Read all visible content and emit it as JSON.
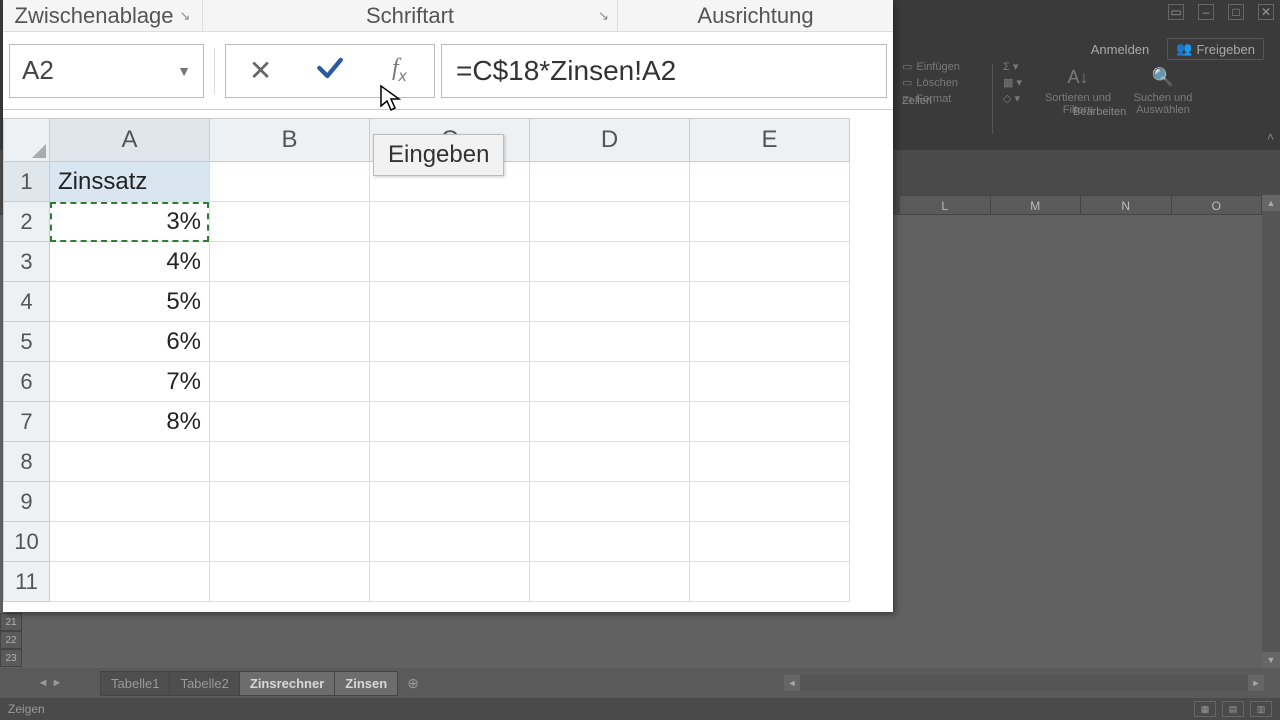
{
  "ribbon": {
    "groups": {
      "clipboard": "Zwischenablage",
      "font": "Schriftart",
      "alignment": "Ausrichtung"
    }
  },
  "account": {
    "login": "Anmelden",
    "share": "Freigeben"
  },
  "right_ribbon": {
    "cells": {
      "insert": "Einfügen",
      "delete": "Löschen",
      "format": "Format",
      "section": "Zellen"
    },
    "editing": {
      "sort": "Sortieren und Filtern",
      "find": "Suchen und Auswählen",
      "section": "Bearbeiten"
    }
  },
  "namebox": "A2",
  "formula": "=C$18*Zinsen!A2",
  "tooltip": "Eingeben",
  "columns": [
    "A",
    "B",
    "C",
    "D",
    "E"
  ],
  "bg_columns": [
    "L",
    "M",
    "N",
    "O"
  ],
  "rows": [
    {
      "n": "1",
      "A": "Zinssatz"
    },
    {
      "n": "2",
      "A": "3%"
    },
    {
      "n": "3",
      "A": "4%"
    },
    {
      "n": "4",
      "A": "5%"
    },
    {
      "n": "5",
      "A": "6%"
    },
    {
      "n": "6",
      "A": "7%"
    },
    {
      "n": "7",
      "A": "8%"
    },
    {
      "n": "8",
      "A": ""
    },
    {
      "n": "9",
      "A": ""
    },
    {
      "n": "10",
      "A": ""
    },
    {
      "n": "11",
      "A": ""
    }
  ],
  "bg_rownums": [
    "21",
    "22",
    "23"
  ],
  "tabs": {
    "items": [
      "Tabelle1",
      "Tabelle2",
      "Zinsrechner",
      "Zinsen"
    ],
    "active": [
      false,
      false,
      true,
      true
    ]
  },
  "status": "Zeigen"
}
